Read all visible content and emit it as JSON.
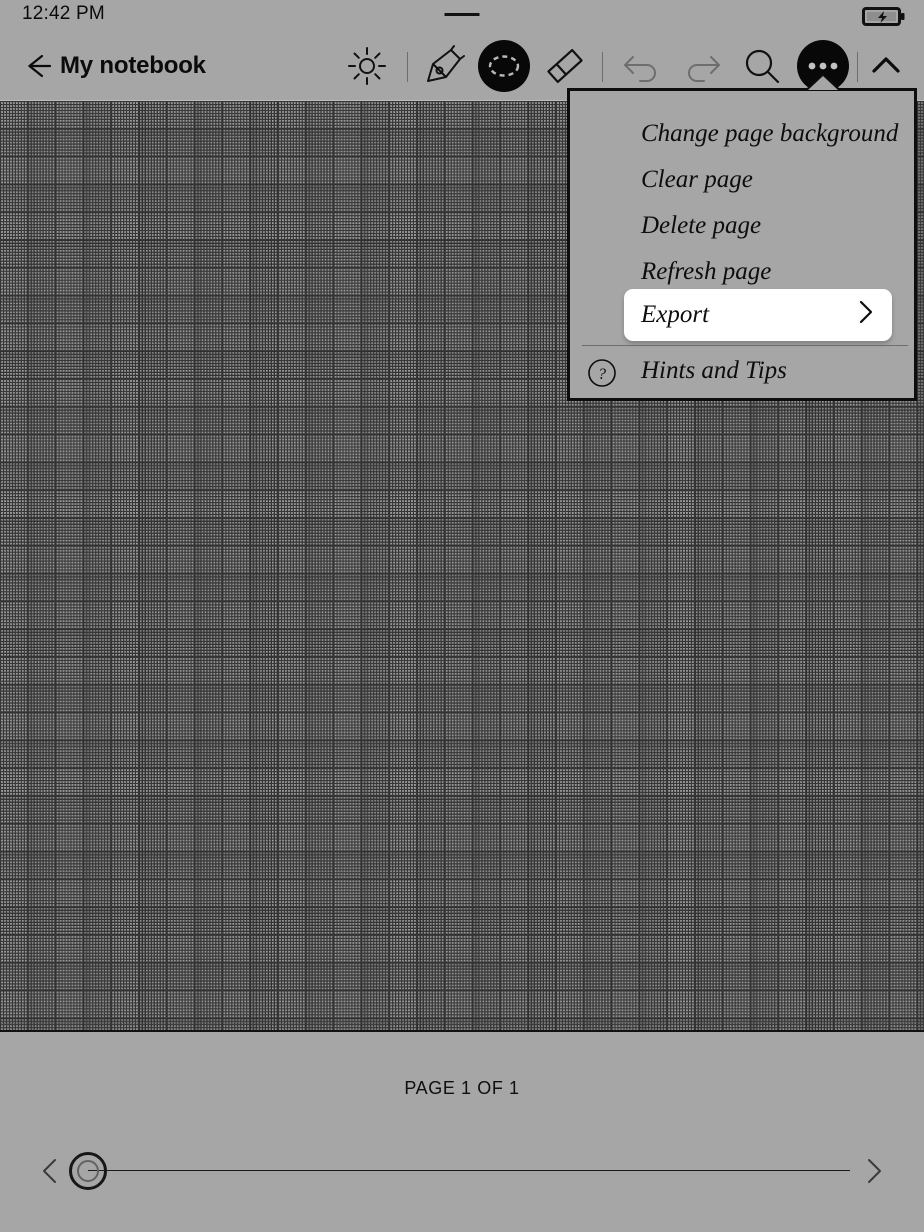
{
  "status_bar": {
    "time": "12:42 PM",
    "battery_icon": "battery-charging-icon",
    "drag_handle_icon": "drag-handle-icon"
  },
  "toolbar": {
    "back_icon": "back-arrow-icon",
    "title": "My notebook",
    "tools": [
      {
        "name": "brightness-icon",
        "label": "Brightness",
        "active": false,
        "disabled": false
      },
      {
        "name": "pen-icon",
        "label": "Pen",
        "active": false,
        "disabled": false
      },
      {
        "name": "lasso-select-icon",
        "label": "Select",
        "active": true,
        "disabled": false
      },
      {
        "name": "eraser-icon",
        "label": "Eraser",
        "active": false,
        "disabled": false
      },
      {
        "name": "undo-icon",
        "label": "Undo",
        "active": false,
        "disabled": true
      },
      {
        "name": "redo-icon",
        "label": "Redo",
        "active": false,
        "disabled": true
      },
      {
        "name": "search-icon",
        "label": "Search",
        "active": false,
        "disabled": false
      },
      {
        "name": "more-options-icon",
        "label": "More",
        "active": true,
        "disabled": false
      },
      {
        "name": "chevron-up-icon",
        "label": "Collapse",
        "active": false,
        "disabled": false
      }
    ]
  },
  "menu": {
    "items": [
      {
        "label": "Change page background",
        "name": "menu-item-change-page-background",
        "highlighted": false
      },
      {
        "label": "Clear page",
        "name": "menu-item-clear-page",
        "highlighted": false
      },
      {
        "label": "Delete page",
        "name": "menu-item-delete-page",
        "highlighted": false
      },
      {
        "label": "Refresh page",
        "name": "menu-item-refresh-page",
        "highlighted": false
      }
    ],
    "export": {
      "label": "Export",
      "chevron_icon": "chevron-right-icon",
      "highlighted": true
    },
    "hints": {
      "label": "Hints and Tips",
      "icon": "question-mark-circle-icon"
    }
  },
  "footer": {
    "page_indicator": "PAGE 1 OF 1",
    "prev_icon": "chevron-left-icon",
    "next_icon": "chevron-right-icon",
    "slider_handle": "page-slider-handle"
  },
  "colors": {
    "background": "#a6a6a6",
    "ink": "#0d0d0d",
    "highlight": "#ffffff",
    "disabled": "#6e6e6e"
  },
  "canvas": {
    "background_type": "grid"
  }
}
